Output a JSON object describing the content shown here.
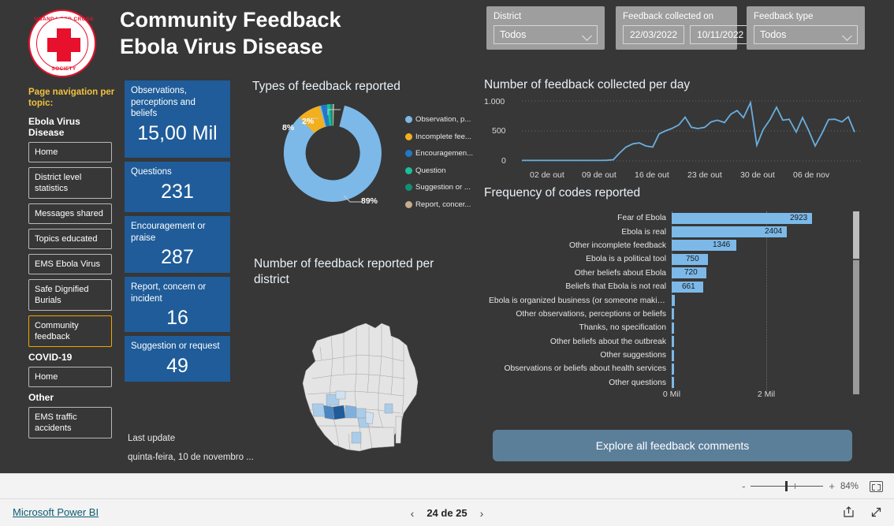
{
  "header": {
    "logo_top_text": "UGANDA RED CROSS",
    "logo_bottom_text": "SOCIETY",
    "title_line1": "Community Feedback",
    "title_line2": "Ebola Virus Disease"
  },
  "slicers": {
    "district": {
      "label": "District",
      "value": "Todos"
    },
    "date": {
      "label": "Feedback collected on",
      "start": "22/03/2022",
      "end": "10/11/2022"
    },
    "feedback_type": {
      "label": "Feedback type",
      "value": "Todos"
    }
  },
  "navigation": {
    "heading": "Page navigation per topic:",
    "groups": [
      {
        "name": "Ebola Virus Disease",
        "items": [
          {
            "label": "Home",
            "active": false
          },
          {
            "label": "District level statistics",
            "active": false
          },
          {
            "label": "Messages shared",
            "active": false
          },
          {
            "label": "Topics educated",
            "active": false
          },
          {
            "label": "EMS Ebola Virus",
            "active": false
          },
          {
            "label": "Safe Dignified Burials",
            "active": false
          },
          {
            "label": "Community feedback",
            "active": true
          }
        ]
      },
      {
        "name": "COVID-19",
        "items": [
          {
            "label": "Home",
            "active": false
          }
        ]
      },
      {
        "name": "Other",
        "items": [
          {
            "label": "EMS traffic accidents",
            "active": false
          }
        ]
      }
    ]
  },
  "kpis": [
    {
      "label": "Observations, perceptions and beliefs",
      "value": "15,00 Mil"
    },
    {
      "label": "Questions",
      "value": "231"
    },
    {
      "label": "Encouragement or praise",
      "value": "287"
    },
    {
      "label": "Report, concern or incident",
      "value": "16"
    },
    {
      "label": "Suggestion or request",
      "value": "49"
    }
  ],
  "last_update": {
    "label": "Last update",
    "value": "quinta-feira, 10 de novembro ..."
  },
  "panels": {
    "donut_title": "Types of feedback reported",
    "map_title": "Number of feedback reported per district",
    "line_title": "Number of feedback collected per day",
    "bars_title": "Frequency of codes reported"
  },
  "explore_button": "Explore all feedback comments",
  "statusbar": {
    "zoom": "84%"
  },
  "footer": {
    "brand": "Microsoft Power BI",
    "page": "24 de 25"
  },
  "chart_data": [
    {
      "type": "pie",
      "title": "Types of feedback reported",
      "labels": [
        "Observation, p...",
        "Incomplete fee...",
        "Encouragemen...",
        "Question",
        "Suggestion or ...",
        "Report, concer..."
      ],
      "values": [
        89,
        8,
        2,
        0.6,
        0.3,
        0.1
      ],
      "value_labels": [
        "89%",
        "8%",
        "2%"
      ],
      "colors": [
        "#7cb9e8",
        "#f2b01e",
        "#2079c7",
        "#1bbf9c",
        "#118f77",
        "#c6ab8e"
      ],
      "legend_position": "right",
      "donut": true
    },
    {
      "type": "line",
      "title": "Number of feedback collected per day",
      "xlabel": "",
      "ylabel": "",
      "ylim": [
        0,
        1000
      ],
      "yticks": [
        0,
        500,
        1000
      ],
      "ytick_labels": [
        "0",
        "500",
        "1.000"
      ],
      "xtick_labels": [
        "02 de out",
        "09 de out",
        "16 de out",
        "23 de out",
        "30 de out",
        "06 de nov"
      ],
      "grid": true,
      "color": "#6aaede",
      "values": [
        8,
        8,
        8,
        8,
        8,
        8,
        8,
        8,
        8,
        8,
        8,
        8,
        8,
        10,
        20,
        130,
        230,
        285,
        300,
        250,
        230,
        450,
        500,
        540,
        600,
        730,
        560,
        540,
        560,
        650,
        680,
        640,
        780,
        840,
        720,
        970,
        260,
        520,
        700,
        900,
        680,
        700,
        480,
        720,
        500,
        250,
        470,
        690,
        700,
        650,
        740,
        480
      ]
    },
    {
      "type": "bar",
      "orientation": "horizontal",
      "title": "Frequency of codes reported",
      "xlabel": "",
      "ylabel": "",
      "xtick_labels": [
        "0 Mil",
        "2 Mil"
      ],
      "xlim": [
        0,
        3200
      ],
      "color": "#7cb9e8",
      "categories": [
        "Fear of Ebola",
        "Ebola is real",
        "Other incomplete feedback",
        "Ebola is a political tool",
        "Other beliefs about Ebola",
        "Beliefs that Ebola is not real",
        "Ebola is organized business (or someone makin...",
        "Other observations, perceptions or beliefs",
        "Thanks, no specification",
        "Other beliefs about the outbreak",
        "Other suggestions",
        "Observations or beliefs about health services",
        "Other questions"
      ],
      "values": [
        2923,
        2404,
        1346,
        750,
        720,
        661,
        60,
        48,
        40,
        36,
        30,
        26,
        22
      ],
      "value_labels": [
        "2923",
        "2404",
        "1346",
        "750",
        "720",
        "661",
        "",
        "",
        "",
        "",
        "",
        "",
        ""
      ]
    },
    {
      "type": "heatmap",
      "subtype": "choropleth",
      "title": "Number of feedback reported per district",
      "region": "Uganda",
      "base_color": "#e4e4e4",
      "scale_colors": [
        "#cfe1f2",
        "#a9ccea",
        "#7fb0db",
        "#4a86c0",
        "#1f5c99"
      ]
    }
  ]
}
